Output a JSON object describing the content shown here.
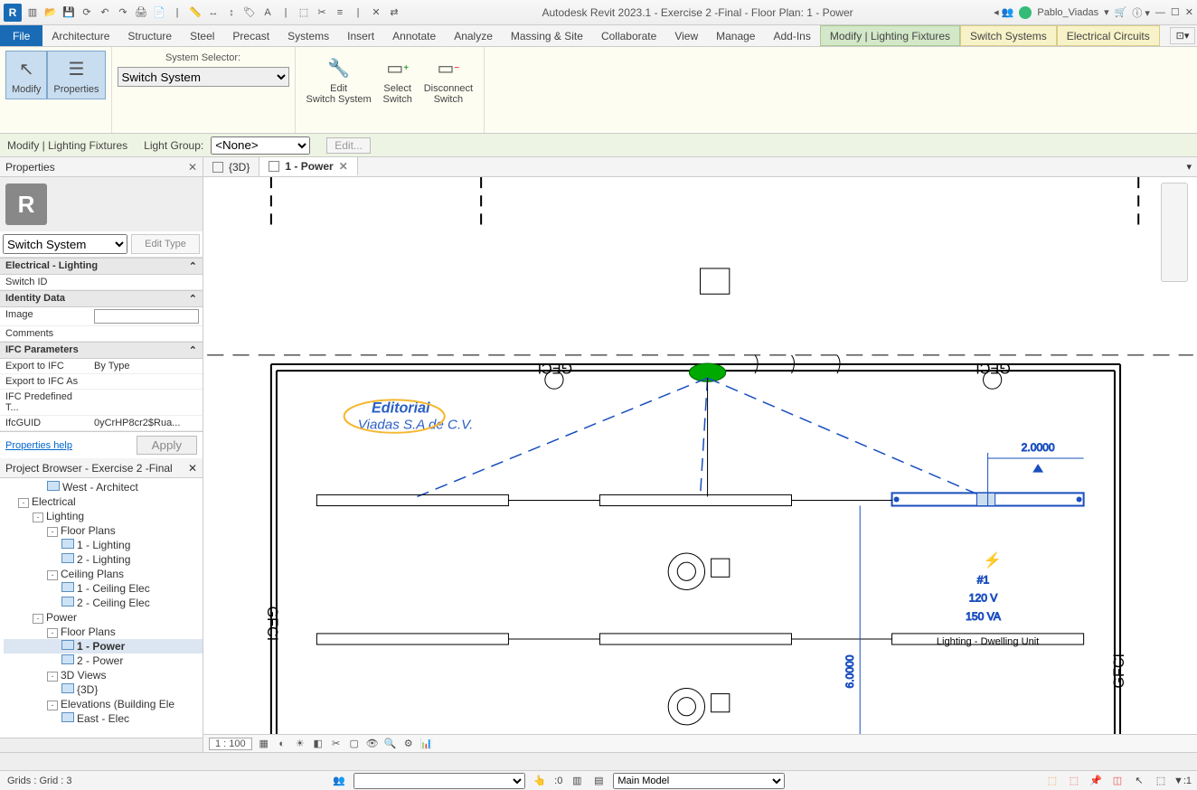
{
  "app": {
    "title": "Autodesk Revit 2023.1 - Exercise 2 -Final - Floor Plan: 1 - Power",
    "user": "Pablo_Viadas"
  },
  "menutabs": {
    "file": "File",
    "items": [
      "Architecture",
      "Structure",
      "Steel",
      "Precast",
      "Systems",
      "Insert",
      "Annotate",
      "Analyze",
      "Massing & Site",
      "Collaborate",
      "View",
      "Manage",
      "Add-Ins"
    ],
    "ctx": [
      "Modify | Lighting Fixtures",
      "Switch Systems",
      "Electrical Circuits"
    ]
  },
  "ribbon": {
    "modify": "Modify",
    "properties": "Properties",
    "sysselector_label": "System Selector:",
    "sysselector_value": "Switch System",
    "edit_switch": "Edit\nSwitch System",
    "select_switch": "Select\nSwitch",
    "disconnect_switch": "Disconnect\nSwitch"
  },
  "optbar": {
    "context": "Modify | Lighting Fixtures",
    "lightgroup_label": "Light Group:",
    "lightgroup_value": "<None>",
    "edit": "Edit..."
  },
  "properties": {
    "title": "Properties",
    "type": "Switch System",
    "edittype": "Edit Type",
    "groups": [
      {
        "name": "Electrical - Lighting",
        "rows": [
          {
            "k": "Switch ID",
            "v": ""
          }
        ]
      },
      {
        "name": "Identity Data",
        "rows": [
          {
            "k": "Image",
            "v": ""
          },
          {
            "k": "Comments",
            "v": ""
          }
        ]
      },
      {
        "name": "IFC Parameters",
        "rows": [
          {
            "k": "Export to IFC",
            "v": "By Type"
          },
          {
            "k": "Export to IFC As",
            "v": ""
          },
          {
            "k": "IFC Predefined T...",
            "v": ""
          },
          {
            "k": "IfcGUID",
            "v": "0yCrHP8cr2$Rua..."
          }
        ]
      }
    ],
    "help": "Properties help",
    "apply": "Apply"
  },
  "browser": {
    "title": "Project Browser - Exercise 2 -Final",
    "tree": [
      {
        "lvl": 3,
        "label": "West - Architect",
        "icon": true
      },
      {
        "lvl": 1,
        "label": "Electrical",
        "exp": "-"
      },
      {
        "lvl": 2,
        "label": "Lighting",
        "exp": "-"
      },
      {
        "lvl": 3,
        "label": "Floor Plans",
        "exp": "-"
      },
      {
        "lvl": 4,
        "label": "1 - Lighting",
        "icon": true
      },
      {
        "lvl": 4,
        "label": "2 - Lighting",
        "icon": true
      },
      {
        "lvl": 3,
        "label": "Ceiling Plans",
        "exp": "-"
      },
      {
        "lvl": 4,
        "label": "1 - Ceiling Elec",
        "icon": true
      },
      {
        "lvl": 4,
        "label": "2 - Ceiling Elec",
        "icon": true
      },
      {
        "lvl": 2,
        "label": "Power",
        "exp": "-"
      },
      {
        "lvl": 3,
        "label": "Floor Plans",
        "exp": "-"
      },
      {
        "lvl": 4,
        "label": "1 - Power",
        "icon": true,
        "active": true
      },
      {
        "lvl": 4,
        "label": "2 - Power",
        "icon": true
      },
      {
        "lvl": 3,
        "label": "3D Views",
        "exp": "-"
      },
      {
        "lvl": 4,
        "label": "{3D}",
        "icon": true
      },
      {
        "lvl": 3,
        "label": "Elevations (Building Ele",
        "exp": "-"
      },
      {
        "lvl": 4,
        "label": "East - Elec",
        "icon": true
      }
    ]
  },
  "viewtabs": {
    "tabs": [
      {
        "label": "{3D}",
        "active": false
      },
      {
        "label": "1 - Power",
        "active": true
      }
    ]
  },
  "canvas": {
    "watermark1": "Editorial",
    "watermark2": "Viadas S.A de C.V.",
    "gfci": "GFCI",
    "dim1": "2.0000",
    "dim2": "6.0000",
    "circuit_num": "#1",
    "circuit_v": "120 V",
    "circuit_va": "150 VA",
    "circuit_name": "Lighting - Dwelling Unit"
  },
  "viewctrl": {
    "scale": "1 : 100"
  },
  "status": {
    "left": "Grids : Grid : 3",
    "sel": ":0",
    "model": "Main Model"
  }
}
